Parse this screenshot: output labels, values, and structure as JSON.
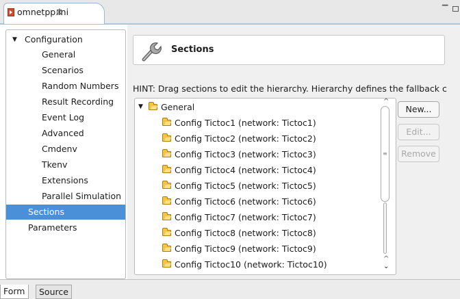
{
  "editor": {
    "tab_title": "omnetpp.ini",
    "tab_close_glyph": "⊠",
    "view_menu_glyph": "▔"
  },
  "left_tree": {
    "root_label": "Configuration",
    "children": [
      "General",
      "Scenarios",
      "Random Numbers",
      "Result Recording",
      "Event Log",
      "Advanced",
      "Cmdenv",
      "Tkenv",
      "Extensions",
      "Parallel Simulation"
    ],
    "sections_label": "Sections",
    "parameters_label": "Parameters",
    "selected": "Sections"
  },
  "header": {
    "icon": "wrench-icon",
    "title": "Sections"
  },
  "hint": "HINT: Drag sections to edit the hierarchy. Hierarchy defines the fallback c",
  "sections_tree": {
    "root": "General",
    "children": [
      "Config Tictoc1 (network: Tictoc1)",
      "Config Tictoc2 (network: Tictoc2)",
      "Config Tictoc3 (network: Tictoc3)",
      "Config Tictoc4 (network: Tictoc4)",
      "Config Tictoc5 (network: Tictoc5)",
      "Config Tictoc6 (network: Tictoc6)",
      "Config Tictoc7 (network: Tictoc7)",
      "Config Tictoc8 (network: Tictoc8)",
      "Config Tictoc9 (network: Tictoc9)",
      "Config Tictoc10 (network: Tictoc10)"
    ]
  },
  "buttons": {
    "new": "New...",
    "edit": "Edit...",
    "remove": "Remove"
  },
  "bottom_tabs": [
    "Form",
    "Source"
  ],
  "colors": {
    "selection": "#4a90d9",
    "folder": "#f5c542",
    "tab_border": "#aec4dd"
  }
}
